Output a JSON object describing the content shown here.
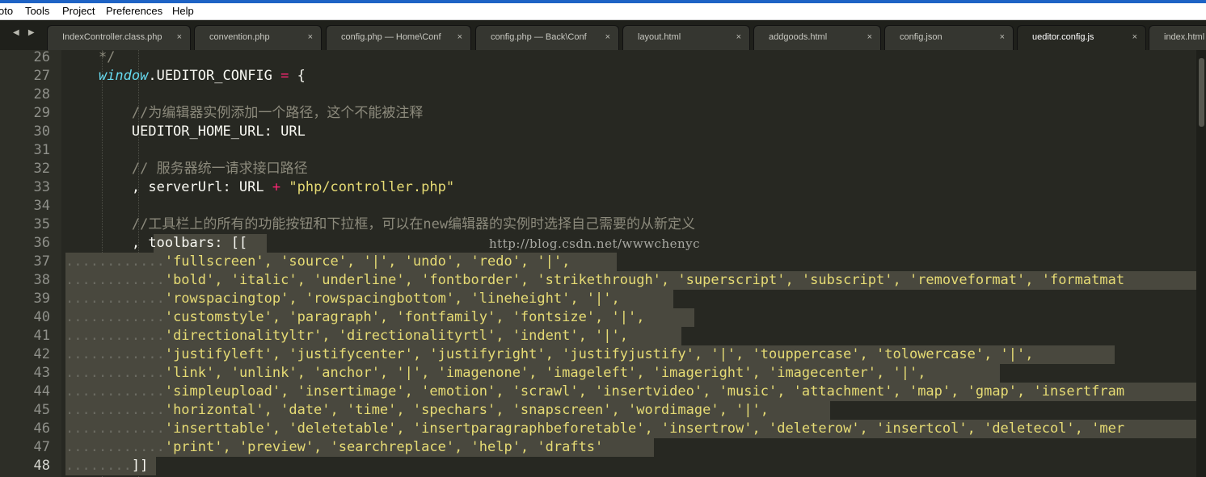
{
  "menu": [
    "oto",
    "Tools",
    "Project",
    "Preferences",
    "Help"
  ],
  "tabs": [
    {
      "label": "IndexController.class.php"
    },
    {
      "label": "convention.php"
    },
    {
      "label": "config.php — Home\\Conf"
    },
    {
      "label": "config.php — Back\\Conf"
    },
    {
      "label": "layout.html"
    },
    {
      "label": "addgoods.html"
    },
    {
      "label": "config.json"
    },
    {
      "label": "ueditor.config.js",
      "active": true
    },
    {
      "label": "index.html"
    }
  ],
  "close_glyph": "×",
  "nav_arrows": "◀ ▶",
  "watermark": "http://blog.csdn.net/wwwchenyc",
  "current_line": 48,
  "lines": [
    {
      "n": 26,
      "tokens": [
        {
          "t": "    */",
          "c": "cm"
        }
      ]
    },
    {
      "n": 27,
      "tokens": [
        {
          "t": "    "
        },
        {
          "t": "window",
          "c": "it"
        },
        {
          "t": ".UEDITOR_CONFIG "
        },
        {
          "t": "=",
          "c": "op"
        },
        {
          "t": " {"
        }
      ]
    },
    {
      "n": 28,
      "tokens": []
    },
    {
      "n": 29,
      "tokens": [
        {
          "t": "        //为编辑器实例添加一个路径，这个不能被注释",
          "c": "cm"
        }
      ]
    },
    {
      "n": 30,
      "tokens": [
        {
          "t": "        UEDITOR_HOME_URL: URL"
        }
      ]
    },
    {
      "n": 31,
      "tokens": []
    },
    {
      "n": 32,
      "tokens": [
        {
          "t": "        // 服务器统一请求接口路径",
          "c": "cm"
        }
      ]
    },
    {
      "n": 33,
      "tokens": [
        {
          "t": "        , serverUrl: URL "
        },
        {
          "t": "+",
          "c": "op"
        },
        {
          "t": " "
        },
        {
          "t": "\"php/controller.php\"",
          "c": "str"
        }
      ]
    },
    {
      "n": 34,
      "tokens": []
    },
    {
      "n": 35,
      "tokens": [
        {
          "t": "        //工具栏上的所有的功能按钮和下拉框，可以在new编辑器的实例时选择自己需要的从新定义",
          "c": "cm"
        }
      ]
    },
    {
      "n": 36,
      "tokens": [
        {
          "t": "        , toolbars: [["
        }
      ]
    },
    {
      "n": 37,
      "tokens": [
        {
          "t": "............",
          "c": "dots"
        },
        {
          "t": "'fullscreen', 'source', '|', 'undo', 'redo', '|',",
          "c": "str"
        }
      ]
    },
    {
      "n": 38,
      "tokens": [
        {
          "t": "............",
          "c": "dots"
        },
        {
          "t": "'bold', 'italic', 'underline', 'fontborder', 'strikethrough', 'superscript', 'subscript', 'removeformat', 'formatmat",
          "c": "str"
        }
      ]
    },
    {
      "n": 39,
      "tokens": [
        {
          "t": "............",
          "c": "dots"
        },
        {
          "t": "'rowspacingtop', 'rowspacingbottom', 'lineheight', '|',",
          "c": "str"
        }
      ]
    },
    {
      "n": 40,
      "tokens": [
        {
          "t": "............",
          "c": "dots"
        },
        {
          "t": "'customstyle', 'paragraph', 'fontfamily', 'fontsize', '|',",
          "c": "str"
        }
      ]
    },
    {
      "n": 41,
      "tokens": [
        {
          "t": "............",
          "c": "dots"
        },
        {
          "t": "'directionalityltr', 'directionalityrtl', 'indent', '|',",
          "c": "str"
        }
      ]
    },
    {
      "n": 42,
      "tokens": [
        {
          "t": "............",
          "c": "dots"
        },
        {
          "t": "'justifyleft', 'justifycenter', 'justifyright', 'justifyjustify', '|', 'touppercase', 'tolowercase', '|',",
          "c": "str"
        }
      ]
    },
    {
      "n": 43,
      "tokens": [
        {
          "t": "............",
          "c": "dots"
        },
        {
          "t": "'link', 'unlink', 'anchor', '|', 'imagenone', 'imageleft', 'imageright', 'imagecenter', '|',",
          "c": "str"
        }
      ]
    },
    {
      "n": 44,
      "tokens": [
        {
          "t": "............",
          "c": "dots"
        },
        {
          "t": "'simpleupload', 'insertimage', 'emotion', 'scrawl', 'insertvideo', 'music', 'attachment', 'map', 'gmap', 'insertfram",
          "c": "str"
        }
      ]
    },
    {
      "n": 45,
      "tokens": [
        {
          "t": "............",
          "c": "dots"
        },
        {
          "t": "'horizontal', 'date', 'time', 'spechars', 'snapscreen', 'wordimage', '|',",
          "c": "str"
        }
      ]
    },
    {
      "n": 46,
      "tokens": [
        {
          "t": "............",
          "c": "dots"
        },
        {
          "t": "'inserttable', 'deletetable', 'insertparagraphbeforetable', 'insertrow', 'deleterow', 'insertcol', 'deletecol', 'mer",
          "c": "str"
        }
      ]
    },
    {
      "n": 47,
      "tokens": [
        {
          "t": "............",
          "c": "dots"
        },
        {
          "t": "'print', 'preview', 'searchreplace', 'help', 'drafts'",
          "c": "str"
        }
      ]
    },
    {
      "n": 48,
      "tokens": [
        {
          "t": "........",
          "c": "dots"
        },
        {
          "t": "]]"
        }
      ]
    }
  ]
}
